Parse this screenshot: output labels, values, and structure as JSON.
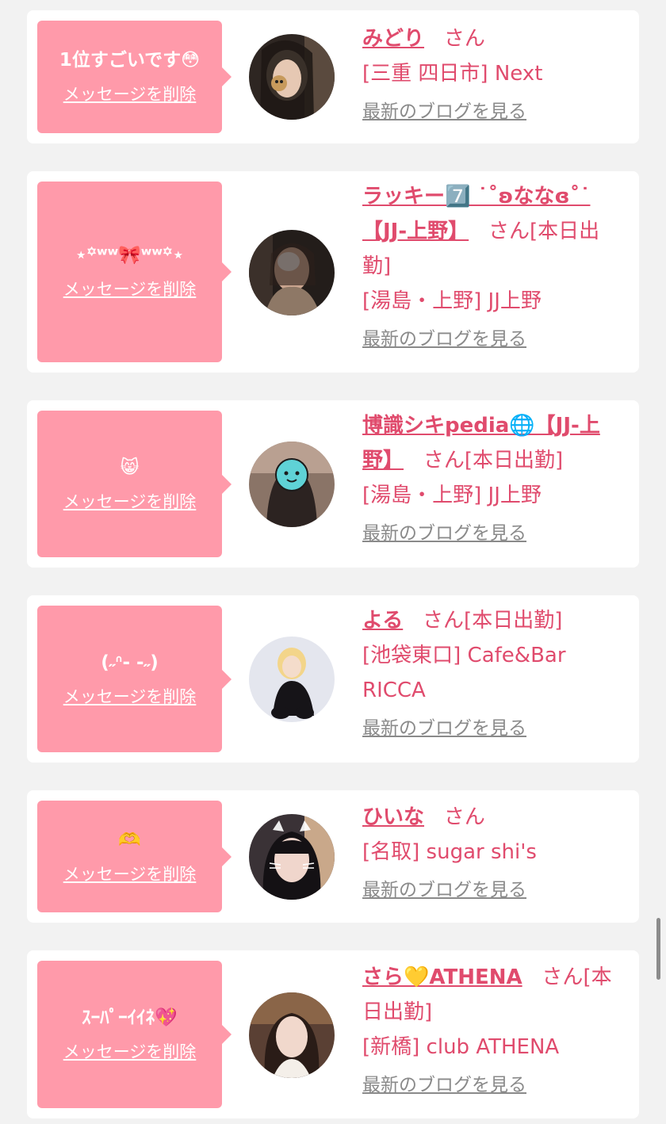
{
  "delete_label": "メッセージを削除",
  "san": "さん",
  "blog_label": "最新のブログを見る",
  "colors": {
    "accent": "#e04b6d",
    "bubble": "#ff9aaa",
    "background": "#f2f2f2"
  },
  "cards": [
    {
      "message": "1位すごいです😳",
      "name": "みどり",
      "suffix": "",
      "shop": "[三重 四日市] Next",
      "avatar_tone": "#3b2f2a"
    },
    {
      "message": "⋆꙳ʷʷ🎀ʷʷ꙳⋆",
      "name": "ラッキー7️⃣ ˙˚ʚななɞ˚˙ 【JJ-上野】",
      "suffix": "[本日出勤]",
      "shop": "[湯島・上野] JJ上野",
      "avatar_tone": "#2a2624"
    },
    {
      "message": "😸",
      "name": "博識シキpedia🌐【JJ-上野】",
      "suffix": "[本日出勤]",
      "shop": "[湯島・上野] JJ上野",
      "avatar_tone": "#6b5a52"
    },
    {
      "message": "(˶ᐢ- -˶)",
      "name": "よる",
      "suffix": "[本日出勤]",
      "shop": "[池袋東口] Cafe&Bar RICCA",
      "avatar_tone": "#dfe2ec"
    },
    {
      "message": "🫶",
      "name": "ひいな",
      "suffix": "",
      "shop": "[名取] sugar shi's",
      "avatar_tone": "#3a3336"
    },
    {
      "message": "ｽｰﾊﾟｰｲｲﾈ💖",
      "name": "さら💛ATHENA",
      "suffix": "[本日出勤]",
      "shop": "[新橋] club ATHENA",
      "avatar_tone": "#4a3a33"
    }
  ]
}
